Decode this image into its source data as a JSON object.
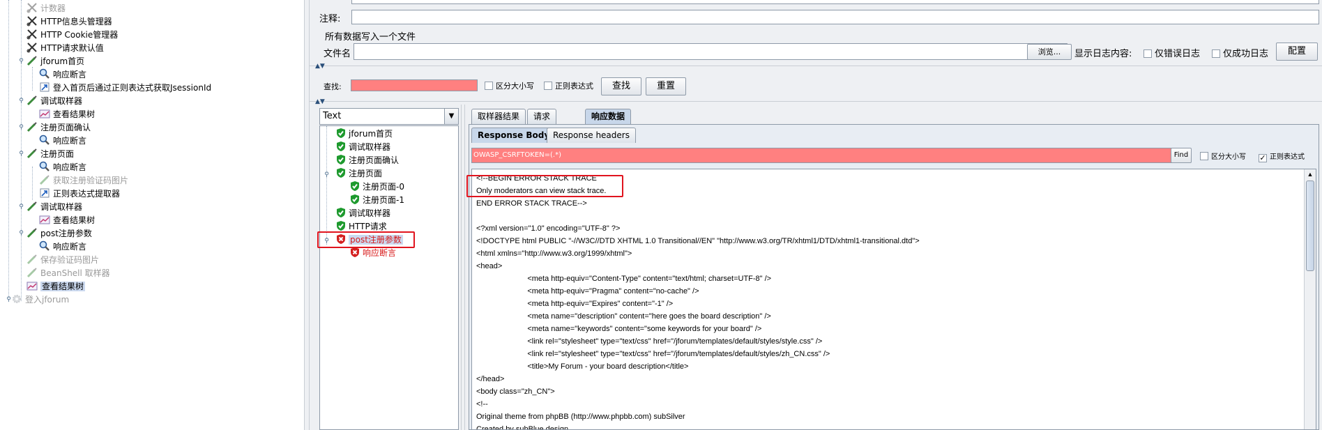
{
  "left_tree": {
    "items": [
      {
        "label": "计数器",
        "icon": "scissors-icon",
        "disabled": true
      },
      {
        "label": "HTTP信息头管理器",
        "icon": "scissors-icon"
      },
      {
        "label": "HTTP Cookie管理器",
        "icon": "scissors-icon"
      },
      {
        "label": "HTTP请求默认值",
        "icon": "scissors-icon"
      },
      {
        "label": "jforum首页",
        "icon": "pipette-icon"
      },
      {
        "label": "响应断言",
        "icon": "magnifier-icon"
      },
      {
        "label": "登入首页后通过正则表达式获取JsessionId",
        "icon": "arrow-icon"
      },
      {
        "label": "调试取样器",
        "icon": "pipette-icon"
      },
      {
        "label": "查看结果树",
        "icon": "chart-icon"
      },
      {
        "label": "注册页面确认",
        "icon": "pipette-icon"
      },
      {
        "label": "响应断言",
        "icon": "magnifier-icon"
      },
      {
        "label": "注册页面",
        "icon": "pipette-icon"
      },
      {
        "label": "响应断言",
        "icon": "magnifier-icon"
      },
      {
        "label": "获取注册验证码图片",
        "icon": "pipette-icon",
        "disabled": true
      },
      {
        "label": "正则表达式提取器",
        "icon": "arrow-icon"
      },
      {
        "label": "调试取样器",
        "icon": "pipette-icon"
      },
      {
        "label": "查看结果树",
        "icon": "chart-icon"
      },
      {
        "label": "post注册参数",
        "icon": "pipette-icon"
      },
      {
        "label": "响应断言",
        "icon": "magnifier-icon"
      },
      {
        "label": "保存验证码图片",
        "icon": "pipette-icon",
        "disabled": true
      },
      {
        "label": "BeanShell 取样器",
        "icon": "pipette-icon",
        "disabled": true
      },
      {
        "label": "查看结果树",
        "icon": "chart-icon",
        "selected": true
      },
      {
        "label": "登入jforum",
        "icon": "gear-icon",
        "disabled": true
      }
    ]
  },
  "config": {
    "comment_label": "注释:",
    "write_all_label": "所有数据写入一个文件",
    "filename_label": "文件名",
    "browse_button": "浏览...",
    "log_display_label": "显示日志内容:",
    "errors_only_label": "仅错误日志",
    "success_only_label": "仅成功日志",
    "configure_button": "配置"
  },
  "search": {
    "label": "查找:",
    "case_sensitive": "区分大小写",
    "regex": "正则表达式",
    "find_button": "查找",
    "reset_button": "重置"
  },
  "render_select": {
    "value": "Text"
  },
  "result_tree": {
    "items": [
      {
        "label": "jforum首页",
        "status": "pass"
      },
      {
        "label": "调试取样器",
        "status": "pass"
      },
      {
        "label": "注册页面确认",
        "status": "pass"
      },
      {
        "label": "注册页面",
        "status": "pass"
      },
      {
        "label": "注册页面-0",
        "status": "pass"
      },
      {
        "label": "注册页面-1",
        "status": "pass"
      },
      {
        "label": "调试取样器",
        "status": "pass"
      },
      {
        "label": "HTTP请求",
        "status": "pass"
      },
      {
        "label": "post注册参数",
        "status": "fail"
      },
      {
        "label": "响应断言",
        "status": "fail"
      }
    ]
  },
  "main_tabs": [
    {
      "label": "取样器结果"
    },
    {
      "label": "请求"
    },
    {
      "label": "响应数据",
      "active": true
    }
  ],
  "sub_tabs": [
    {
      "label": "Response Body",
      "active": true
    },
    {
      "label": "Response headers"
    }
  ],
  "body_search": {
    "value": "OWASP_CSRFTOKEN=(.*)",
    "find_button": "Find",
    "case_sensitive": "区分大小写",
    "regex": "正则表达式",
    "regex_checked": true
  },
  "response_lines": [
    "<!--BEGIN ERROR STACK TRACE",
    "Only moderators can view stack trace.",
    "END ERROR STACK TRACE-->",
    "",
    "<?xml version=\"1.0\" encoding=\"UTF-8\" ?>",
    "<!DOCTYPE html PUBLIC \"-//W3C//DTD XHTML 1.0 Transitional//EN\" \"http://www.w3.org/TR/xhtml1/DTD/xhtml1-transitional.dtd\">",
    "<html xmlns=\"http://www.w3.org/1999/xhtml\">",
    "<head>",
    "                        <meta http-equiv=\"Content-Type\" content=\"text/html; charset=UTF-8\" />",
    "                        <meta http-equiv=\"Pragma\" content=\"no-cache\" />",
    "                        <meta http-equiv=\"Expires\" content=\"-1\" />",
    "                        <meta name=\"description\" content=\"here goes the board description\" />",
    "                        <meta name=\"keywords\" content=\"some keywords for your board\" />",
    "                        <link rel=\"stylesheet\" type=\"text/css\" href=\"/jforum/templates/default/styles/style.css\" />",
    "                        <link rel=\"stylesheet\" type=\"text/css\" href=\"/jforum/templates/default/styles/zh_CN.css\" />",
    "                        <title>My Forum - your board description</title>",
    "</head>",
    "<body class=\"zh_CN\">",
    "<!--",
    "Original theme from phpBB (http://www.phpbb.com) subSilver",
    "Created by subBlue design"
  ],
  "colors": {
    "search_highlight": "#ff8080",
    "annotation_red": "#e0141e",
    "pass_green": "#1e9a2e",
    "fail_red": "#d42020"
  }
}
